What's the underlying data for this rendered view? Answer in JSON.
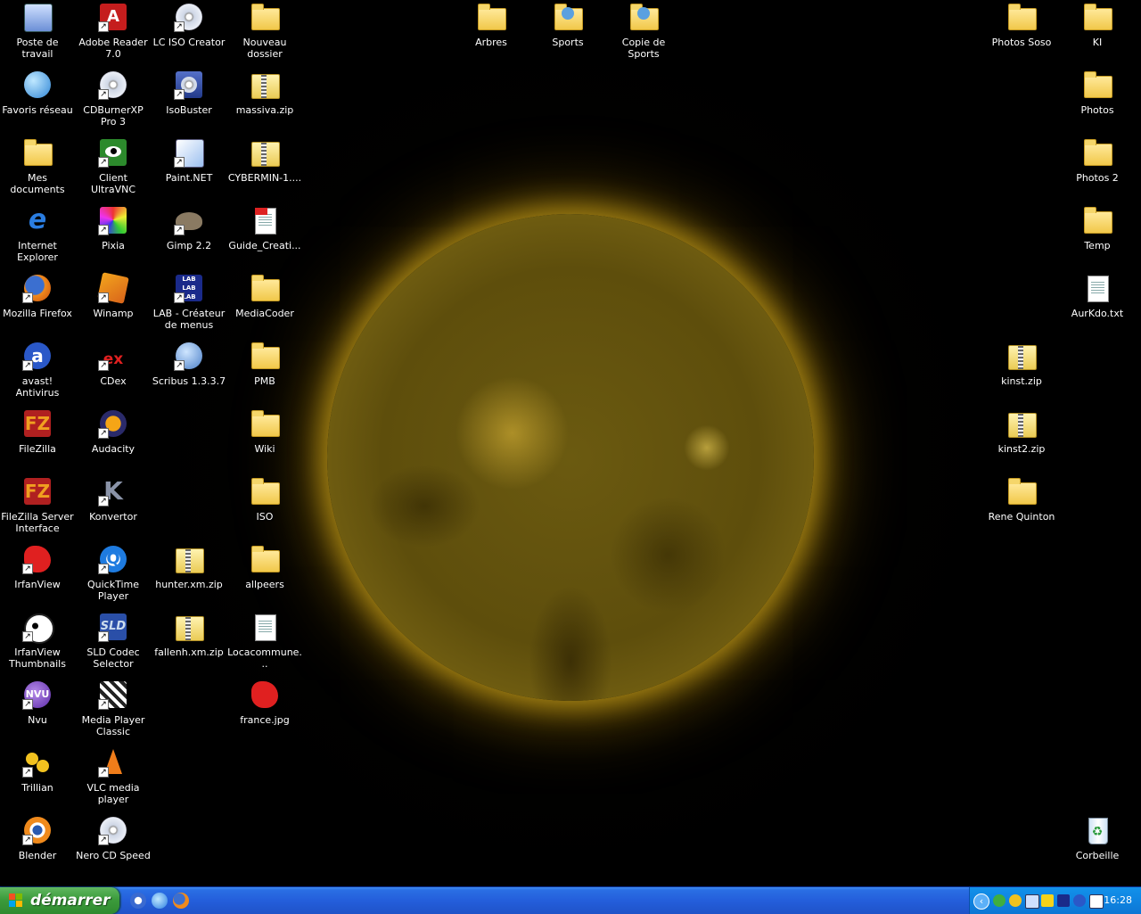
{
  "desktop": {
    "left_col1": [
      "Poste de travail",
      "Favoris réseau",
      "Mes documents",
      "Internet Explorer",
      "Mozilla Firefox",
      "avast! Antivirus",
      "FileZilla",
      "FileZilla Server Interface",
      "IrfanView",
      "IrfanView Thumbnails",
      "Nvu",
      "Trillian",
      "Blender"
    ],
    "left_col2": [
      "Adobe Reader 7.0",
      "CDBurnerXP Pro 3",
      "Client UltraVNC",
      "Pixia",
      "Winamp",
      "CDex",
      "Audacity",
      "Konvertor",
      "QuickTime Player",
      "SLD Codec Selector",
      "Media Player Classic",
      "VLC media player",
      "Nero CD Speed"
    ],
    "left_col3": [
      "LC ISO Creator",
      "IsoBuster",
      "Paint.NET",
      "Gimp 2.2",
      "LAB - Créateur de menus",
      "Scribus 1.3.3.7",
      "hunter.xm.zip",
      "fallenh.xm.zip"
    ],
    "left_col4": [
      "Nouveau dossier",
      "massiva.zip",
      "CYBERMIN-1....",
      "Guide_Creati...",
      "MediaCoder",
      "PMB",
      "Wiki",
      "ISO",
      "allpeers",
      "Locacommune...",
      "france.jpg"
    ],
    "top_middle": [
      "Arbres",
      "Sports",
      "Copie de Sports"
    ],
    "right_col1": [
      "Photos Soso",
      "kinst.zip",
      "kinst2.zip",
      "Rene Quinton"
    ],
    "right_col2": [
      "KI",
      "Photos",
      "Photos 2",
      "Temp",
      "AurKdo.txt",
      "Corbeille"
    ]
  },
  "taskbar": {
    "start_label": "démarrer",
    "clock": "16:28",
    "tray_expand_glyph": "‹"
  },
  "colors": {
    "taskbar_blue": "#245edb",
    "start_green": "#3c9b3c",
    "tray_blue": "#0f84e1",
    "sun_gold": "#e6c23c"
  }
}
